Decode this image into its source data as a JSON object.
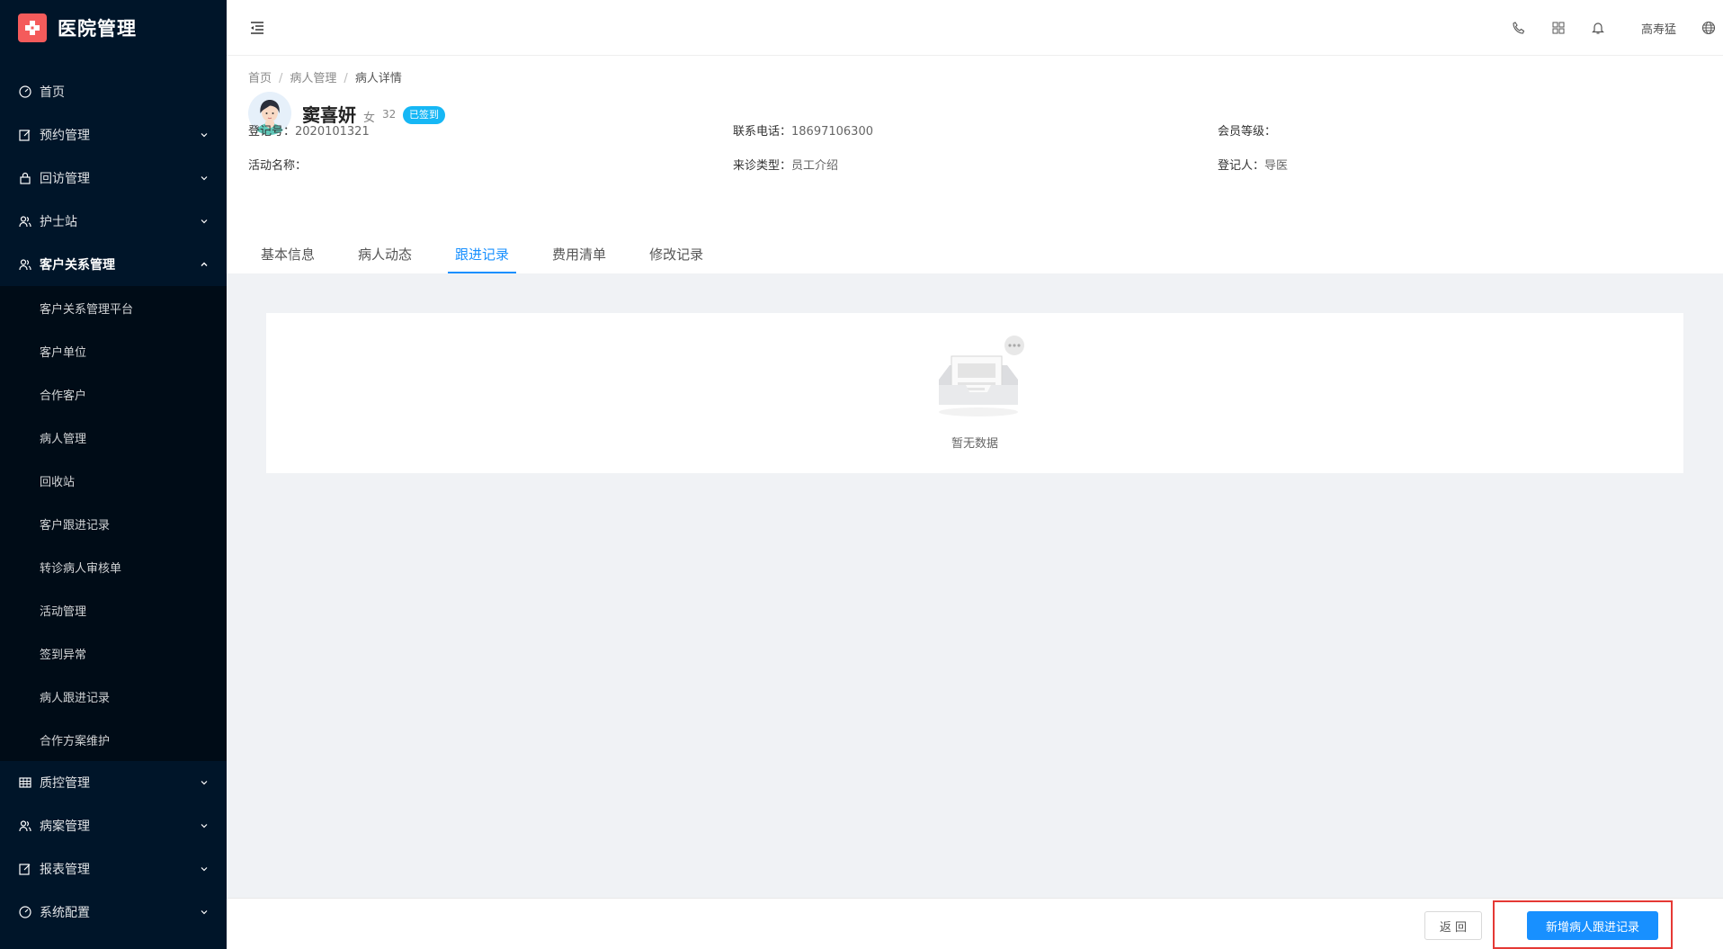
{
  "app": {
    "title": "医院管理"
  },
  "sidebar": {
    "items": [
      {
        "label": "首页",
        "icon": "dashboard-icon"
      },
      {
        "label": "预约管理",
        "icon": "edit-icon"
      },
      {
        "label": "回访管理",
        "icon": "lock-icon"
      },
      {
        "label": "护士站",
        "icon": "user-group-icon"
      },
      {
        "label": "客户关系管理",
        "icon": "user-group-icon",
        "open": true
      },
      {
        "label": "质控管理",
        "icon": "table-icon"
      },
      {
        "label": "病案管理",
        "icon": "user-group-icon"
      },
      {
        "label": "报表管理",
        "icon": "edit-icon"
      },
      {
        "label": "系统配置",
        "icon": "dashboard-icon"
      }
    ],
    "sub_items": [
      "客户关系管理平台",
      "客户单位",
      "合作客户",
      "病人管理",
      "回收站",
      "客户跟进记录",
      "转诊病人审核单",
      "活动管理",
      "签到异常",
      "病人跟进记录",
      "合作方案维护"
    ]
  },
  "header": {
    "user": "高寿猛"
  },
  "breadcrumb": [
    "首页",
    "病人管理",
    "病人详情"
  ],
  "patient": {
    "name": "窦喜妍",
    "gender": "女",
    "age": "32",
    "status": "已签到",
    "fields": [
      {
        "label": "登记号：",
        "value": "2020101321"
      },
      {
        "label": "联系电话：",
        "value": "18697106300"
      },
      {
        "label": "会员等级：",
        "value": ""
      },
      {
        "label": "活动名称：",
        "value": ""
      },
      {
        "label": "来诊类型：",
        "value": "员工介绍"
      },
      {
        "label": "登记人：",
        "value": "导医"
      }
    ]
  },
  "tabs": [
    "基本信息",
    "病人动态",
    "跟进记录",
    "费用清单",
    "修改记录"
  ],
  "active_tab": 2,
  "content": {
    "empty_text": "暂无数据"
  },
  "footer": {
    "back_label": "返 回",
    "add_label": "新增病人跟进记录"
  },
  "colors": {
    "sidebar_bg": "#001529",
    "primary": "#1890ff",
    "badge": "#16b7f5",
    "logo": "#f45b5b",
    "highlight": "#e53935"
  }
}
